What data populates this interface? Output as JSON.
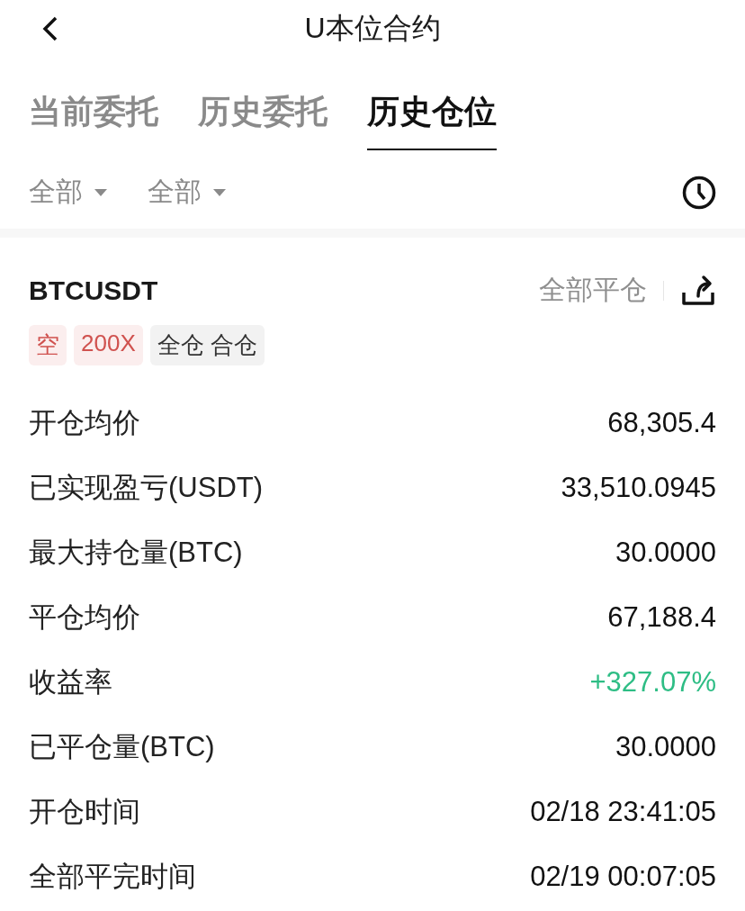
{
  "header": {
    "title": "U本位合约"
  },
  "tabs": [
    {
      "label": "当前委托",
      "selected": false
    },
    {
      "label": "历史委托",
      "selected": false
    },
    {
      "label": "历史仓位",
      "selected": true
    }
  ],
  "filters": [
    {
      "label": "全部"
    },
    {
      "label": "全部"
    }
  ],
  "position": {
    "symbol": "BTCUSDT",
    "close_all": "全部平仓",
    "tags": [
      {
        "label": "空",
        "kind": "short"
      },
      {
        "label": "200X",
        "kind": "leverage"
      },
      {
        "label": "全仓 合仓",
        "kind": "margin"
      }
    ],
    "rows": [
      {
        "label": "开仓均价",
        "value": "68,305.4",
        "kind": "plain"
      },
      {
        "label": "已实现盈亏(USDT)",
        "value": "33,510.0945",
        "kind": "plain"
      },
      {
        "label": "最大持仓量(BTC)",
        "value": "30.0000",
        "kind": "plain"
      },
      {
        "label": "平仓均价",
        "value": "67,188.4",
        "kind": "plain"
      },
      {
        "label": "收益率",
        "value": "+327.07%",
        "kind": "gain"
      },
      {
        "label": "已平仓量(BTC)",
        "value": "30.0000",
        "kind": "plain"
      },
      {
        "label": "开仓时间",
        "value": "02/18 23:41:05",
        "kind": "plain"
      },
      {
        "label": "全部平完时间",
        "value": "02/19 00:07:05",
        "kind": "plain"
      }
    ]
  }
}
